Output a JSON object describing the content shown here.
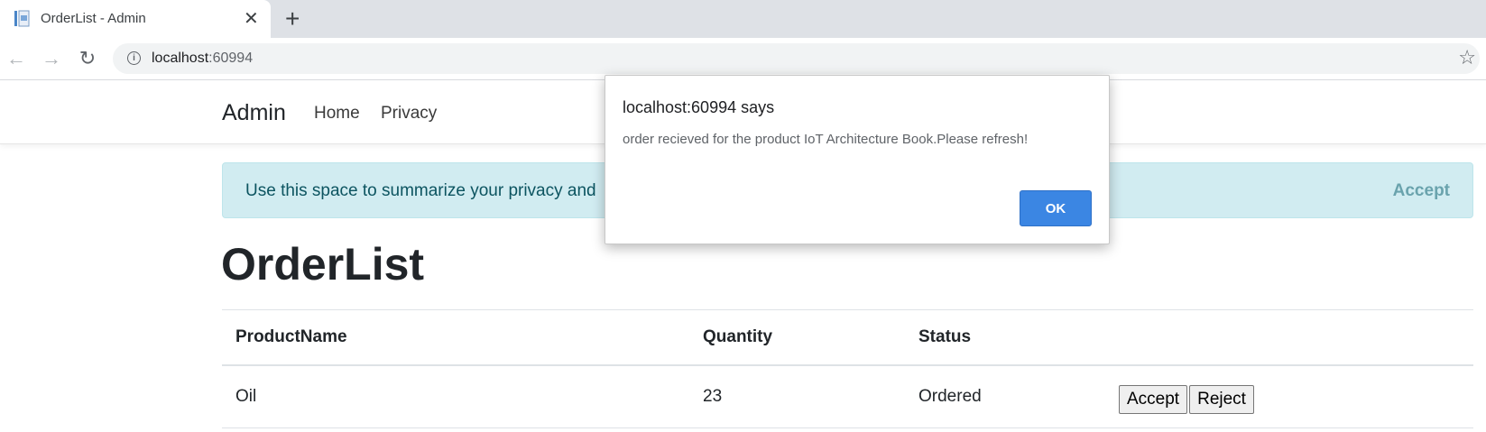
{
  "browser": {
    "tab_title": "OrderList - Admin",
    "tab_close": "✕",
    "new_tab": "+",
    "back": "←",
    "forward": "→",
    "reload": "↻",
    "info": "i",
    "url_host": "localhost",
    "url_port": ":60994",
    "star": "☆"
  },
  "navbar": {
    "brand": "Admin",
    "links": [
      "Home",
      "Privacy"
    ]
  },
  "cookie": {
    "text": "Use this space to summarize your privacy and",
    "accept": "Accept",
    "color": "#d1ecf1"
  },
  "page": {
    "title": "OrderList"
  },
  "table": {
    "headers": [
      "ProductName",
      "Quantity",
      "Status",
      ""
    ],
    "rows": [
      {
        "product": "Oil",
        "quantity": "23",
        "status": "Ordered",
        "accept": "Accept",
        "reject": "Reject"
      }
    ]
  },
  "dialog": {
    "title": "localhost:60994 says",
    "message": "order recieved for the product IoT Architecture Book.Please refresh!",
    "ok": "OK",
    "ok_color": "#3b86e3"
  }
}
